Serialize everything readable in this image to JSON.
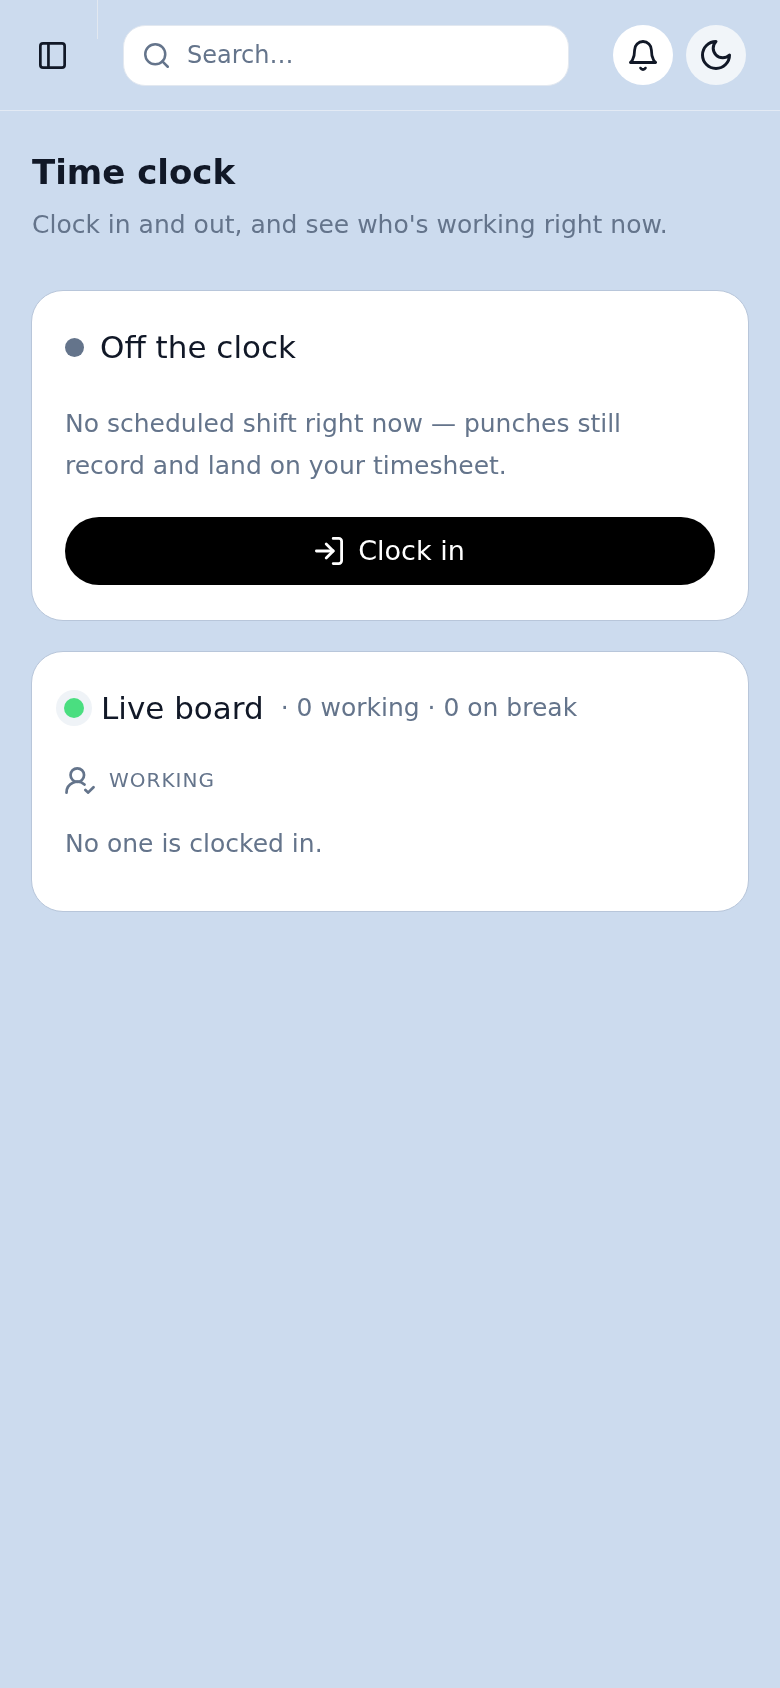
{
  "header": {
    "search": {
      "placeholder": "Search…"
    }
  },
  "page": {
    "title": "Time clock",
    "subtitle": "Clock in and out, and see who's working right now."
  },
  "clock_card": {
    "clocked_in": false,
    "title": "Off the clock",
    "description": "No scheduled shift right now — punches still record and land on your timesheet.",
    "button": {
      "label": "Clock in"
    }
  },
  "live_board": {
    "live": true,
    "title": "Live board",
    "summary": "· 0 working · 0 on break",
    "section": {
      "label": "WORKING",
      "empty_text": "No one is clocked in."
    }
  }
}
